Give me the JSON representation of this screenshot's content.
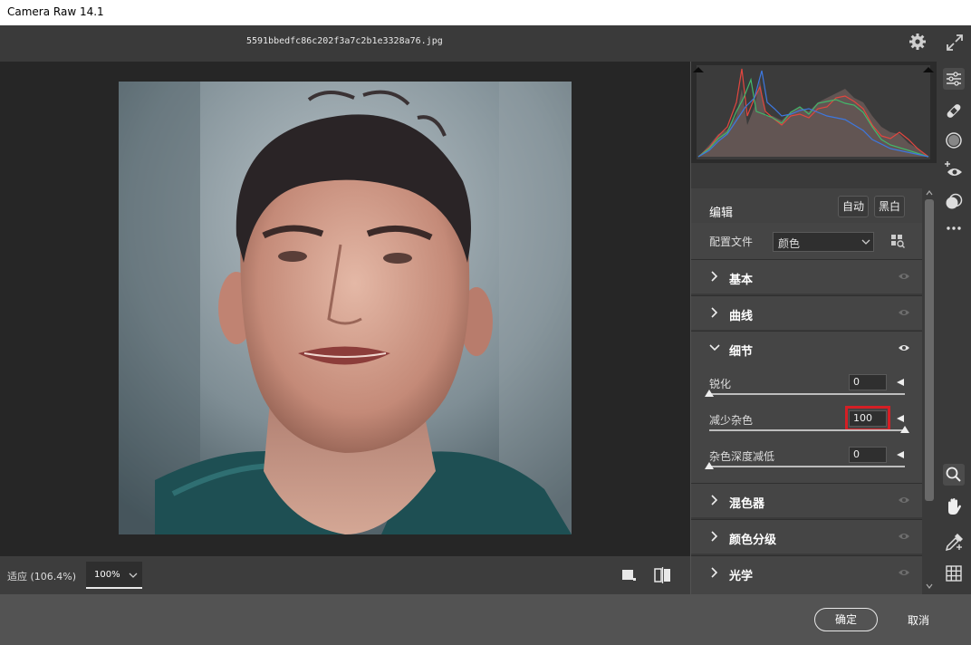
{
  "window": {
    "title": "Camera Raw 14.1"
  },
  "header": {
    "filename": "5591bbedfc86c202f3a7c2b1e3328a76.jpg"
  },
  "bottom_bar": {
    "zoom_fit": "适应 (106.4%)",
    "zoom_value": "100%"
  },
  "right_panel": {
    "edit_label": "编辑",
    "auto_button": "自动",
    "bw_button": "黑白",
    "profile_label": "配置文件",
    "profile_value": "颜色",
    "sections": {
      "basic": "基本",
      "curve": "曲线",
      "detail": "细节",
      "mixer": "混色器",
      "color_grading": "颜色分级",
      "optics": "光学"
    },
    "detail_sliders": [
      {
        "label": "锐化",
        "value": "0",
        "level": 0.0
      },
      {
        "label": "减少杂色",
        "value": "100",
        "level": 1.0
      },
      {
        "label": "杂色深度减低",
        "value": "0",
        "level": 0.0
      }
    ]
  },
  "footer": {
    "ok": "确定",
    "cancel": "取消"
  },
  "colors": {
    "highlight": "#d51f25",
    "panel": "#454545",
    "canvas": "#262626"
  },
  "icons": [
    "settings-gear-icon",
    "fullscreen-expand-icon",
    "edit-sliders-icon",
    "healing-bandage-icon",
    "mask-icon",
    "redeye-icon",
    "presets-icon",
    "more-icon",
    "zoom-icon",
    "hand-icon",
    "color-sampler-icon",
    "grid-overlay-icon",
    "eye-icon",
    "chevron-right-icon",
    "chevron-down-icon"
  ]
}
